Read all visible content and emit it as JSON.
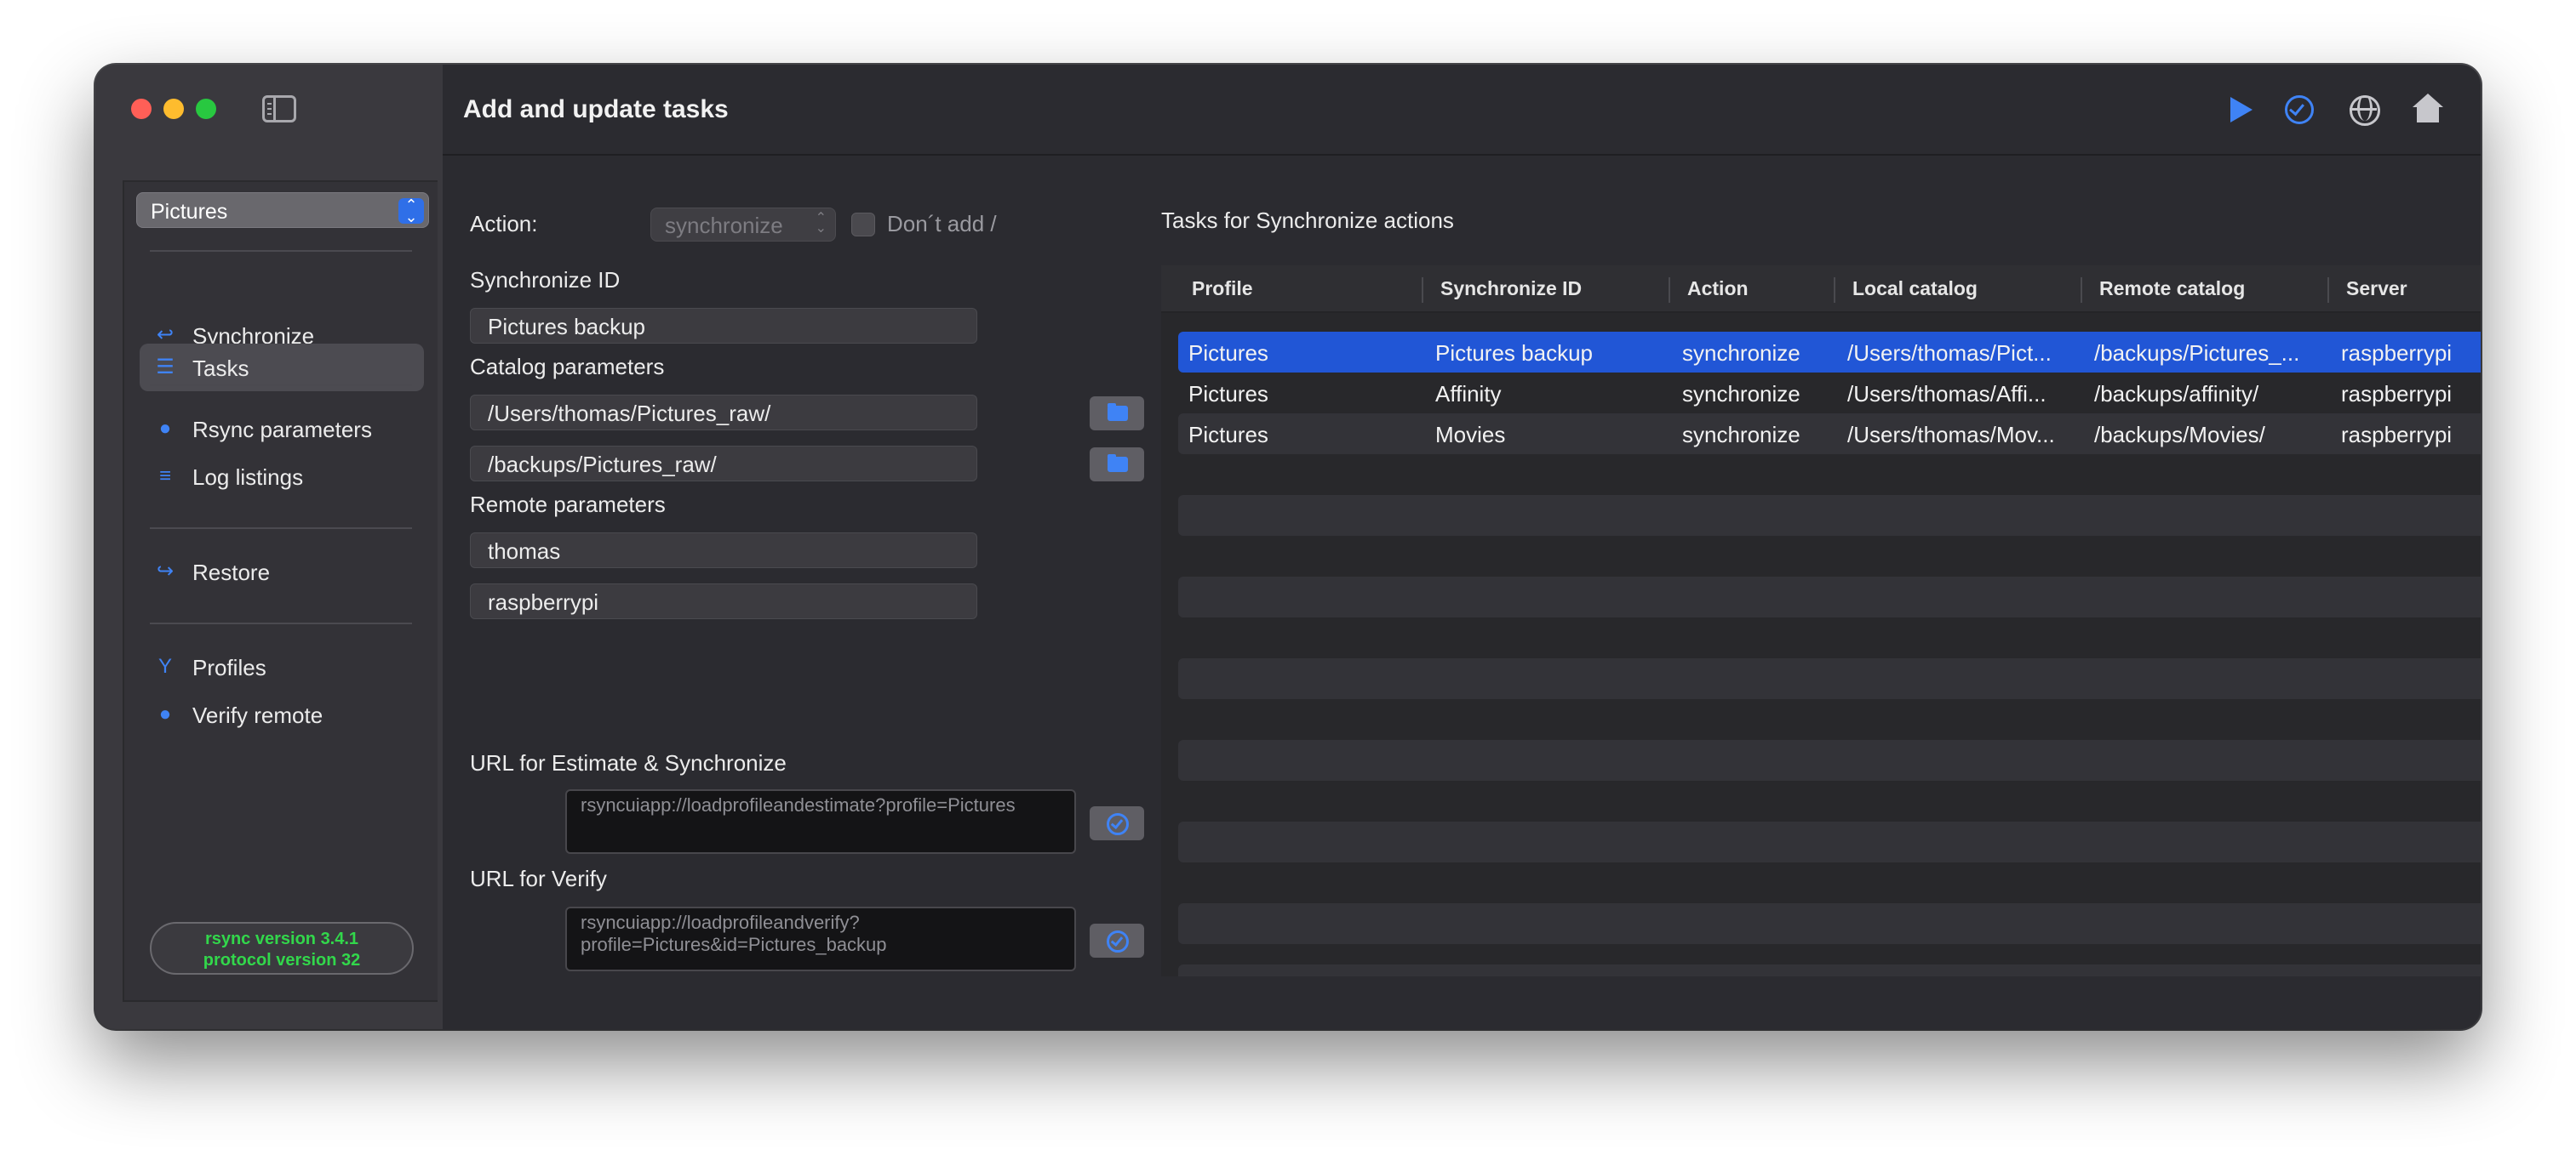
{
  "window": {
    "title": "Add and update tasks"
  },
  "sidebar": {
    "profile": "Pictures",
    "items": [
      {
        "label": "Synchronize",
        "icon": "synchronize-icon"
      },
      {
        "label": "Tasks",
        "icon": "tasks-icon",
        "active": true
      },
      {
        "label": "Rsync parameters",
        "icon": "rsync-parameters-icon"
      },
      {
        "label": "Log listings",
        "icon": "log-listings-icon"
      },
      {
        "label": "Restore",
        "icon": "restore-icon"
      },
      {
        "label": "Profiles",
        "icon": "profiles-icon"
      },
      {
        "label": "Verify remote",
        "icon": "verify-remote-icon"
      }
    ],
    "rsync_version": "rsync  version 3.4.1",
    "protocol_version": "protocol version 32"
  },
  "toolbar": {
    "icons": [
      "play-icon",
      "checkmark-circle-icon",
      "globe-icon",
      "home-icon"
    ]
  },
  "form": {
    "action_label": "Action:",
    "action_value": "synchronize",
    "dont_add_label": "Don´t add /",
    "sync_id_label": "Synchronize ID",
    "sync_id_value": "Pictures backup",
    "catalog_label": "Catalog parameters",
    "local_catalog": "/Users/thomas/Pictures_raw/",
    "remote_catalog": "/backups/Pictures_raw/",
    "remote_label": "Remote parameters",
    "remote_user": "thomas",
    "remote_server": "raspberrypi",
    "url_estimate_label": "URL for Estimate & Synchronize",
    "url_estimate": "rsyncuiapp://loadprofileandestimate?profile=Pictures",
    "url_verify_label": "URL for Verify",
    "url_verify_line1": "rsyncuiapp://loadprofileandverify?",
    "url_verify_line2": "profile=Pictures&id=Pictures_backup"
  },
  "table": {
    "title": "Tasks for Synchronize actions",
    "columns": [
      "Profile",
      "Synchronize ID",
      "Action",
      "Local catalog",
      "Remote catalog",
      "Server"
    ],
    "rows": [
      [
        "Pictures",
        "Pictures backup",
        "synchronize",
        "/Users/thomas/Pict...",
        "/backups/Pictures_...",
        "raspberrypi"
      ],
      [
        "Pictures",
        "Affinity",
        "synchronize",
        "/Users/thomas/Affi...",
        "/backups/affinity/",
        "raspberrypi"
      ],
      [
        "Pictures",
        "Movies",
        "synchronize",
        "/Users/thomas/Mov...",
        "/backups/Movies/",
        "raspberrypi"
      ]
    ],
    "selected_row": 0
  },
  "colors": {
    "accent": "#3f83f5",
    "selection": "#2156d6",
    "rsync_badge_text": "#32d74b"
  }
}
